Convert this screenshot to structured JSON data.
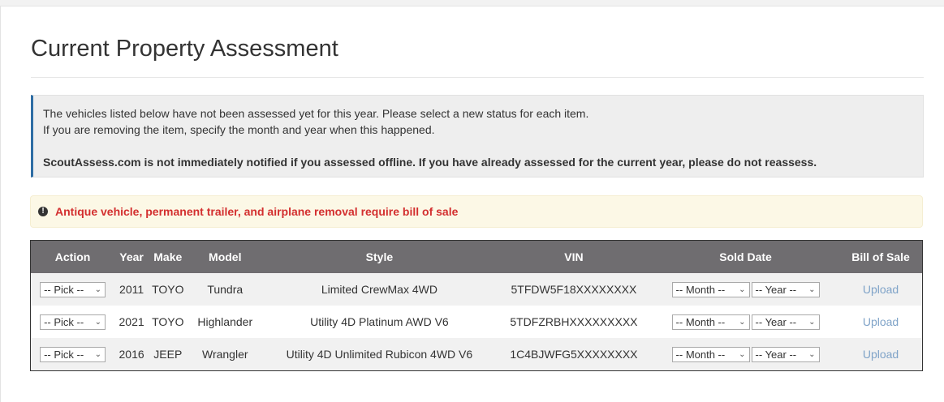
{
  "page_title": "Current Property Assessment",
  "info": {
    "line1": "The vehicles listed below have not been assessed yet for this year. Please select a new status for each item.",
    "line2": "If you are removing the item, specify the month and year when this happened.",
    "line3": "ScoutAssess.com is not immediately notified if you assessed offline. If you have already assessed for the current year, please do not reassess."
  },
  "alert": {
    "icon": "exclamation-circle-icon",
    "text": "Antique vehicle, permanent trailer, and airplane removal require bill of sale",
    "color": "#d32f2f"
  },
  "table": {
    "headers": {
      "action": "Action",
      "year": "Year",
      "make": "Make",
      "model": "Model",
      "style": "Style",
      "vin": "VIN",
      "sold_date": "Sold Date",
      "bill_of_sale": "Bill of Sale"
    },
    "header_bg": "#6f6d70",
    "rows": [
      {
        "action": "-- Pick --",
        "year": "2011",
        "make": "TOYO",
        "model": "Tundra",
        "style": "Limited CrewMax 4WD",
        "vin": "5TFDW5F18XXXXXXXX",
        "month": "-- Month --",
        "sold_year": "-- Year --",
        "upload": "Upload"
      },
      {
        "action": "-- Pick --",
        "year": "2021",
        "make": "TOYO",
        "model": "Highlander",
        "style": "Utility 4D Platinum AWD V6",
        "vin": "5TDFZRBHXXXXXXXXX",
        "month": "-- Month --",
        "sold_year": "-- Year --",
        "upload": "Upload"
      },
      {
        "action": "-- Pick --",
        "year": "2016",
        "make": "JEEP",
        "model": "Wrangler",
        "style": "Utility 4D Unlimited Rubicon 4WD V6",
        "vin": "1C4BJWFG5XXXXXXXX",
        "month": "-- Month --",
        "sold_year": "-- Year --",
        "upload": "Upload"
      }
    ]
  }
}
